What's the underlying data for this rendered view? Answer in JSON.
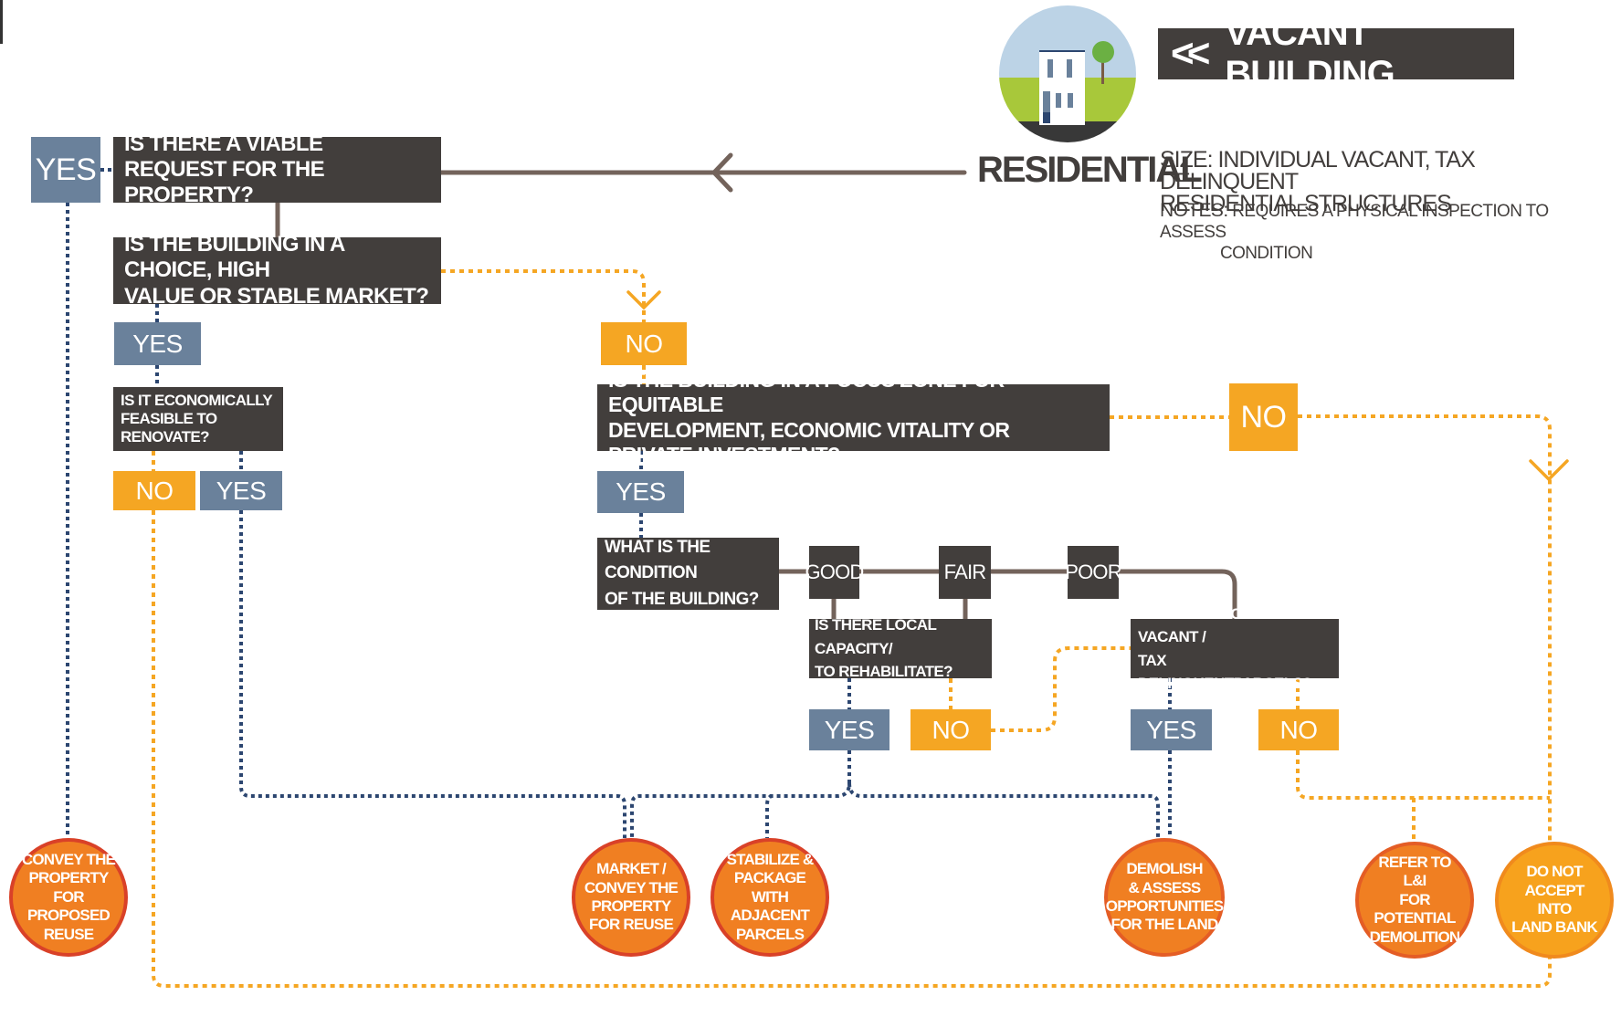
{
  "header": {
    "banner_arrow": "<<",
    "banner_title": "VACANT BUILDING",
    "category": "RESIDENTIAL",
    "icon": "rowhouse-with-tree-icon",
    "size_label": "SIZE:",
    "size_text_line1": "INDIVIDUAL VACANT, TAX DELINQUENT",
    "size_text_line2": "RESIDENTIAL STRUCTURES",
    "notes_label": "NOTES:",
    "notes_text_line1": "REQUIRES A PHYSICAL INSPECTION TO ASSESS",
    "notes_text_line2": "CONDITION"
  },
  "questions": {
    "viable_request": [
      "IS THERE A VIABLE REQUEST FOR THE",
      "PROPERTY?"
    ],
    "choice_market": [
      "IS THE BUILDING IN A CHOICE, HIGH",
      "VALUE OR STABLE MARKET?"
    ],
    "economically_feasible": [
      "IS IT ECONOMICALLY",
      "FEASIBLE TO RENOVATE?"
    ],
    "focus_zone": [
      "IS THE BUILDING IN A FOCUS ZONE FOR EQUITABLE",
      "DEVELOPMENT, ECONOMIC VITALITY OR PRIVATE INVESTMENT?"
    ],
    "condition": [
      "WHAT IS THE CONDITION",
      "OF THE BUILDING?"
    ],
    "local_capacity": [
      "IS THERE LOCAL CAPACITY/",
      "TO REHABILITATE?"
    ],
    "adjacent": [
      "ADJACENT TO OTHER VACANT /",
      "TAX DELINQUENTPARCELS?"
    ]
  },
  "answers": {
    "yes": "YES",
    "no": "NO"
  },
  "conditions": [
    "GOOD",
    "FAIR",
    "POOR"
  ],
  "outcomes": {
    "convey_reuse": [
      "CONVEY THE",
      "PROPERTY",
      "FOR PROPOSED",
      "REUSE"
    ],
    "market_convey": [
      "MARKET /",
      "CONVEY THE",
      "PROPERTY",
      "FOR REUSE"
    ],
    "stabilize": [
      "STABILIZE &",
      "PACKAGE WITH",
      "ADJACENT",
      "PARCELS"
    ],
    "demolish": [
      "DEMOLISH",
      "& ASSESS",
      "OPPORTUNITIES",
      "FOR THE LAND"
    ],
    "refer_li": [
      "REFER TO L&I",
      "FOR POTENTIAL",
      "DEMOLITION"
    ],
    "do_not_accept": [
      "DO NOT",
      "ACCEPT INTO",
      "LAND BANK"
    ]
  },
  "colors": {
    "question_box": "#423e3c",
    "yes": "#6a819b",
    "no": "#f5a623",
    "outcome": "#f07f22",
    "outcome_border": "#d94128",
    "connector_solid": "#73635b",
    "connector_yes": "#2c4670",
    "connector_no": "#f5a623"
  }
}
